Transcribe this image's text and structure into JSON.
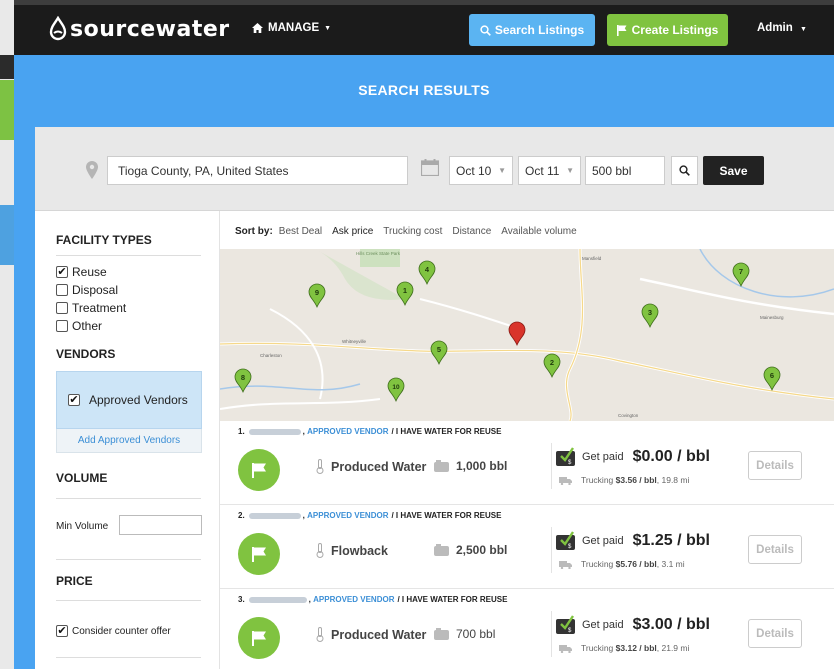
{
  "nav": {
    "logo": "sourcewater",
    "manage": "MANAGE",
    "search_listings": "Search Listings",
    "create_listings": "Create Listings",
    "admin": "Admin"
  },
  "banner": {
    "title": "SEARCH RESULTS"
  },
  "search": {
    "location": "Tioga County, PA, United States",
    "date_from": "Oct 10",
    "date_to": "Oct 11",
    "volume": "500 bbl",
    "save": "Save"
  },
  "sidebar": {
    "facility_types_title": "FACILITY TYPES",
    "facility_types": [
      {
        "label": "Reuse",
        "checked": true
      },
      {
        "label": "Disposal",
        "checked": false
      },
      {
        "label": "Treatment",
        "checked": false
      },
      {
        "label": "Other",
        "checked": false
      }
    ],
    "vendors_title": "VENDORS",
    "approved_vendors": "Approved Vendors",
    "add_approved_vendors": "Add Approved Vendors",
    "volume_title": "VOLUME",
    "min_volume_label": "Min Volume",
    "price_title": "PRICE",
    "consider_counter_offer": "Consider counter offer"
  },
  "sort": {
    "label": "Sort by:",
    "options": [
      "Best Deal",
      "Ask price",
      "Trucking cost",
      "Distance",
      "Available volume"
    ],
    "active": "Ask price"
  },
  "map": {
    "labels": [
      "Hills Creek State Park",
      "Mansfield",
      "Whitneyville",
      "Charleston",
      "Covington",
      "Mainesburg"
    ],
    "markers": [
      "1",
      "2",
      "3",
      "4",
      "5",
      "6",
      "7",
      "8",
      "9",
      "10"
    ]
  },
  "listings": [
    {
      "index": "1.",
      "approved": "APPROVED VENDOR",
      "tag": "/ I HAVE WATER FOR REUSE",
      "water_type": "Produced Water",
      "volume": "1,000 bbl",
      "get_paid": "Get paid",
      "price": "$0.00 / bbl",
      "trucking_prefix": "Trucking",
      "trucking_cost": "$3.56 / bbl",
      "trucking_distance": ", 19.8 mi",
      "details": "Details"
    },
    {
      "index": "2.",
      "approved": "APPROVED VENDOR",
      "tag": "/ I HAVE WATER FOR REUSE",
      "water_type": "Flowback",
      "volume": "2,500 bbl",
      "get_paid": "Get paid",
      "price": "$1.25 / bbl",
      "trucking_prefix": "Trucking",
      "trucking_cost": "$5.76 / bbl",
      "trucking_distance": ", 3.1 mi",
      "details": "Details"
    },
    {
      "index": "3.",
      "approved": "APPROVED VENDOR",
      "tag": "/ I HAVE WATER FOR REUSE",
      "water_type": "Produced Water",
      "volume": "700 bbl",
      "get_paid": "Get paid",
      "price": "$3.00 / bbl",
      "trucking_prefix": "Trucking",
      "trucking_cost": "$3.12 / bbl",
      "trucking_distance": ", 21.9 mi",
      "details": "Details"
    }
  ],
  "colors": {
    "brand_blue": "#49a3f1",
    "brand_green": "#80c340",
    "navbar": "#1b1b1b",
    "link_blue": "#3c8fd6"
  }
}
